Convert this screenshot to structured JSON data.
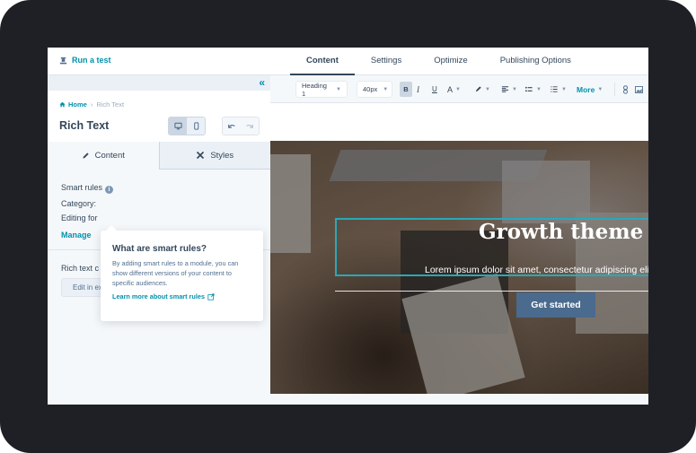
{
  "topbar": {
    "run_test_label": "Run a test",
    "tabs": [
      {
        "label": "Content",
        "active": true
      },
      {
        "label": "Settings",
        "active": false
      },
      {
        "label": "Optimize",
        "active": false
      },
      {
        "label": "Publishing Options",
        "active": false
      }
    ]
  },
  "left_panel": {
    "collapse_icon": "«",
    "breadcrumb": {
      "home": "Home",
      "separator": "›",
      "current": "Rich Text"
    },
    "title": "Rich Text",
    "device_modes": [
      {
        "name": "desktop",
        "active": true
      },
      {
        "name": "mobile",
        "active": false
      }
    ],
    "side_tabs": [
      {
        "label": "Content",
        "icon": "pencil-icon",
        "active": true
      },
      {
        "label": "Styles",
        "icon": "styles-icon",
        "active": false
      }
    ],
    "smart_rules_label": "Smart rules",
    "category_label": "Category:",
    "editing_for_label": "Editing for",
    "manage_label": "Manage",
    "rich_text_label": "Rich text c",
    "edit_external_label": "Edit in external editor"
  },
  "tooltip": {
    "title": "What are smart rules?",
    "body": "By adding smart rules to a module, you can show different versions of your content to specific audiences.",
    "link": "Learn more about smart rules"
  },
  "toolbar": {
    "style_select": "Heading 1",
    "size_select": "40px",
    "buttons": [
      "B",
      "I",
      "U",
      "A"
    ],
    "more_label": "More"
  },
  "hero": {
    "title": "Growth theme",
    "subtitle": "Lorem ipsum dolor sit amet, consectetur adipiscing elit",
    "cta_label": "Get started",
    "selection_color": "#2aa8b8",
    "cta_color": "#4a6a8e"
  },
  "colors": {
    "accent": "#0091ae",
    "text": "#33475b",
    "frame": "#1f2026"
  }
}
